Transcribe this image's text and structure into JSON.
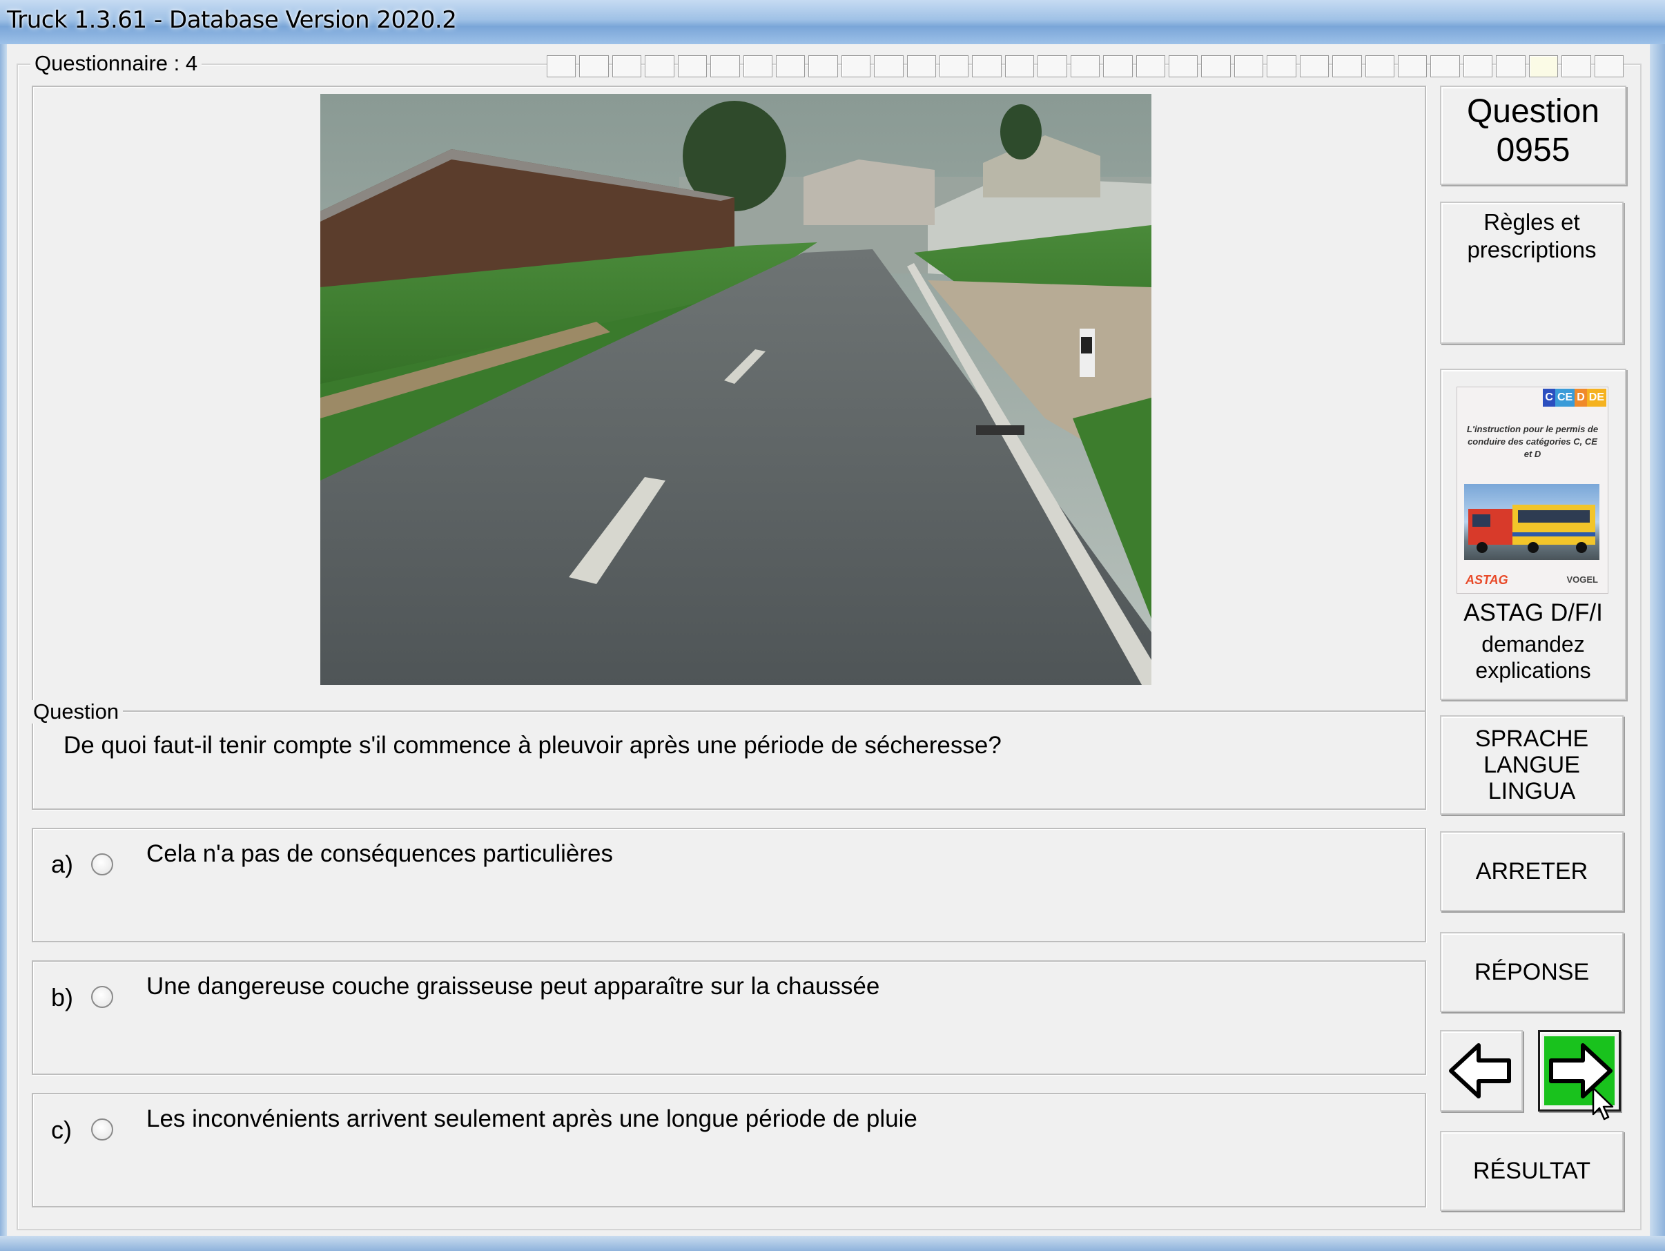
{
  "window": {
    "title": "Truck 1.3.61 - Database Version 2020.2"
  },
  "questionnaire": {
    "label": "Questionnaire : 4",
    "progress_segments": 33,
    "current_segment": 30
  },
  "question": {
    "legend": "Question",
    "text": "De quoi faut-il tenir compte s'il commence à pleuvoir après une période de sécheresse?"
  },
  "answers": [
    {
      "letter": "a)",
      "text": "Cela n'a pas de conséquences particulières",
      "selected": false
    },
    {
      "letter": "b)",
      "text": "Une dangereuse couche graisseuse peut apparaître sur la chaussée",
      "selected": false
    },
    {
      "letter": "c)",
      "text": "Les inconvénients arrivent seulement après une longue période de pluie",
      "selected": false
    }
  ],
  "sidebar": {
    "question_label": "Question",
    "question_number": "0955",
    "category_line1": "Règles et",
    "category_line2": "prescriptions",
    "book": {
      "tabs": [
        "C",
        "CE",
        "D",
        "DE"
      ],
      "cover_text": "L'instruction pour le permis de conduire des catégories C, CE et D",
      "logo_left": "ASTAG",
      "logo_right": "VOGEL",
      "label": "ASTAG D/F/I",
      "sub_line1": "demandez",
      "sub_line2": "explications"
    },
    "lang_line1": "SPRACHE",
    "lang_line2": "LANGUE",
    "lang_line3": "LINGUA",
    "stop_label": "ARRETER",
    "answer_label": "RÉPONSE",
    "result_label": "RÉSULTAT",
    "prev_icon": "arrow-left-icon",
    "next_icon": "arrow-right-icon"
  },
  "colors": {
    "next_button": "#19c21d",
    "tab_c": "#2b4fbf",
    "tab_ce": "#3a9bd8",
    "tab_d": "#f08a2a",
    "tab_de": "#f5b21f"
  }
}
